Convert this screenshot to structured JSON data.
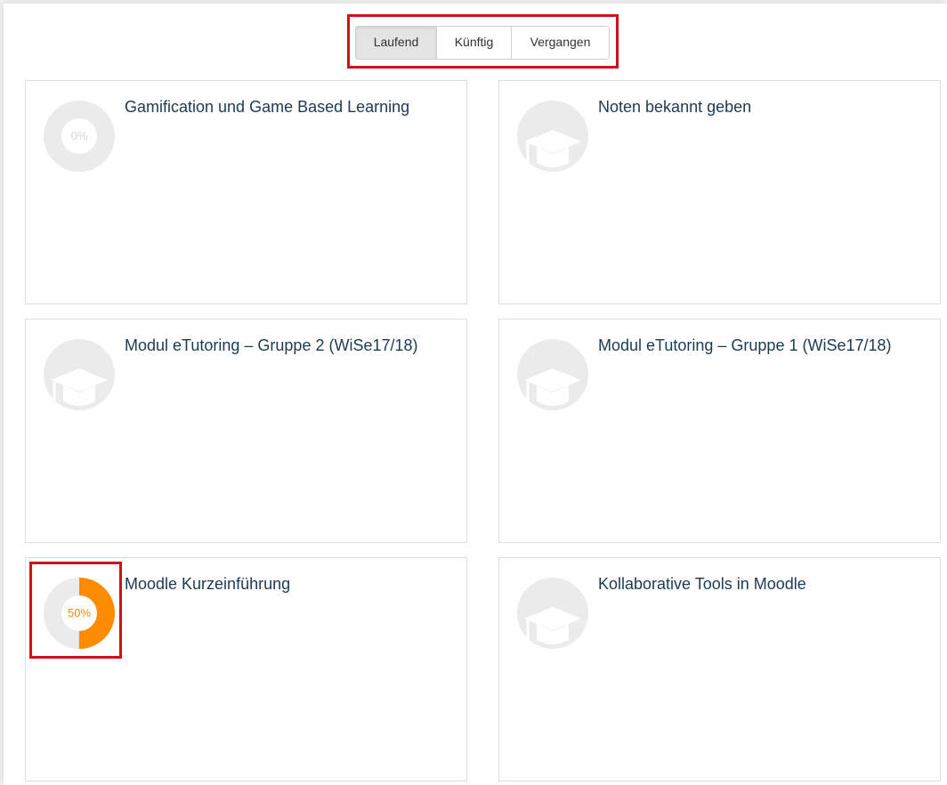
{
  "tabs": [
    {
      "label": "Laufend",
      "active": true
    },
    {
      "label": "Künftig",
      "active": false
    },
    {
      "label": "Vergangen",
      "active": false
    }
  ],
  "courses": [
    {
      "title": "Gamification und Game Based Learning",
      "progress_text": "0%",
      "progress": 0
    },
    {
      "title": "Noten bekannt geben",
      "icon": "graduation-cap-icon"
    },
    {
      "title": "Modul eTutoring – Gruppe 2 (WiSe17/18)",
      "icon": "graduation-cap-icon"
    },
    {
      "title": "Modul eTutoring – Gruppe 1 (WiSe17/18)",
      "icon": "graduation-cap-icon"
    },
    {
      "title": "Moodle Kurzeinführung",
      "progress_text": "50%",
      "progress": 50
    },
    {
      "title": "Kollaborative Tools in Moodle",
      "icon": "graduation-cap-icon"
    }
  ],
  "colors": {
    "progress": "#ff8c00",
    "progress_track": "#ebebeb",
    "title": "#1d3a55",
    "highlight": "#d1111a"
  }
}
